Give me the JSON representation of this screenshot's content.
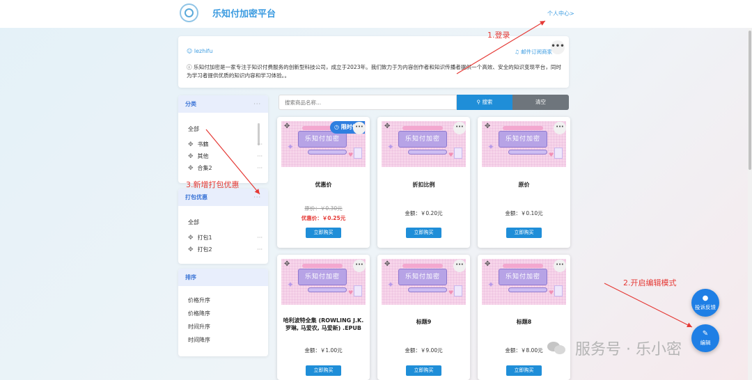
{
  "header": {
    "brand": "乐知付加密平台",
    "user_center": "个人中心"
  },
  "info": {
    "user": "lezhifu",
    "subscribe": "邮件订阅商家",
    "more": "•••",
    "description": "乐知付加密是一家专注于知识付费服务的创新型科技公司，成立于2023年。我们致力于为内容创作者和知识传播者提供一个高效、安全的知识变现平台，同时为学习者提供优质的知识内容和学习体验。。"
  },
  "categories": {
    "title": "分类",
    "more": "···",
    "all": "全部",
    "items": [
      "书籍",
      "其他",
      "合集2"
    ]
  },
  "bundles": {
    "title": "打包优惠",
    "more": "···",
    "all": "全部",
    "items": [
      "打包1",
      "打包2"
    ]
  },
  "sorting": {
    "title": "排序",
    "items": [
      "价格升序",
      "价格降序",
      "时间升序",
      "时间降序"
    ]
  },
  "search": {
    "placeholder": "搜索商品名称...",
    "search_label": "搜索",
    "clear_label": "清空"
  },
  "product_image_text": "乐知付加密",
  "buy_label": "立即购买",
  "limited_label": "限时优",
  "products": [
    {
      "title": "优惠价",
      "original": "原价：￥0.30元",
      "discount": "优惠价：￥0.25元"
    },
    {
      "title": "折扣比例",
      "amount": "金额：￥0.20元"
    },
    {
      "title": "原价",
      "amount": "金额：￥0.10元"
    },
    {
      "title": "哈利波特全集 (ROWLING J.K. 罗琳, 马爱农, 马爱新) .EPUB",
      "amount": "金额：￥1.00元"
    },
    {
      "title": "标题9",
      "amount": "金额：￥9.00元"
    },
    {
      "title": "标题8",
      "amount": "金额：￥8.00元"
    }
  ],
  "float_buttons": {
    "feedback": "投诉反馈",
    "edit": "编辑"
  },
  "annotations": {
    "a1": "1.登录",
    "a2": "2.开启编辑模式",
    "a3": "3.新增打包优惠"
  },
  "watermark": "服务号 · 乐小密",
  "colors": {
    "primary": "#1f8ed8",
    "brand": "#3b9be0",
    "annotation": "#e53935",
    "discount": "#e53935"
  }
}
